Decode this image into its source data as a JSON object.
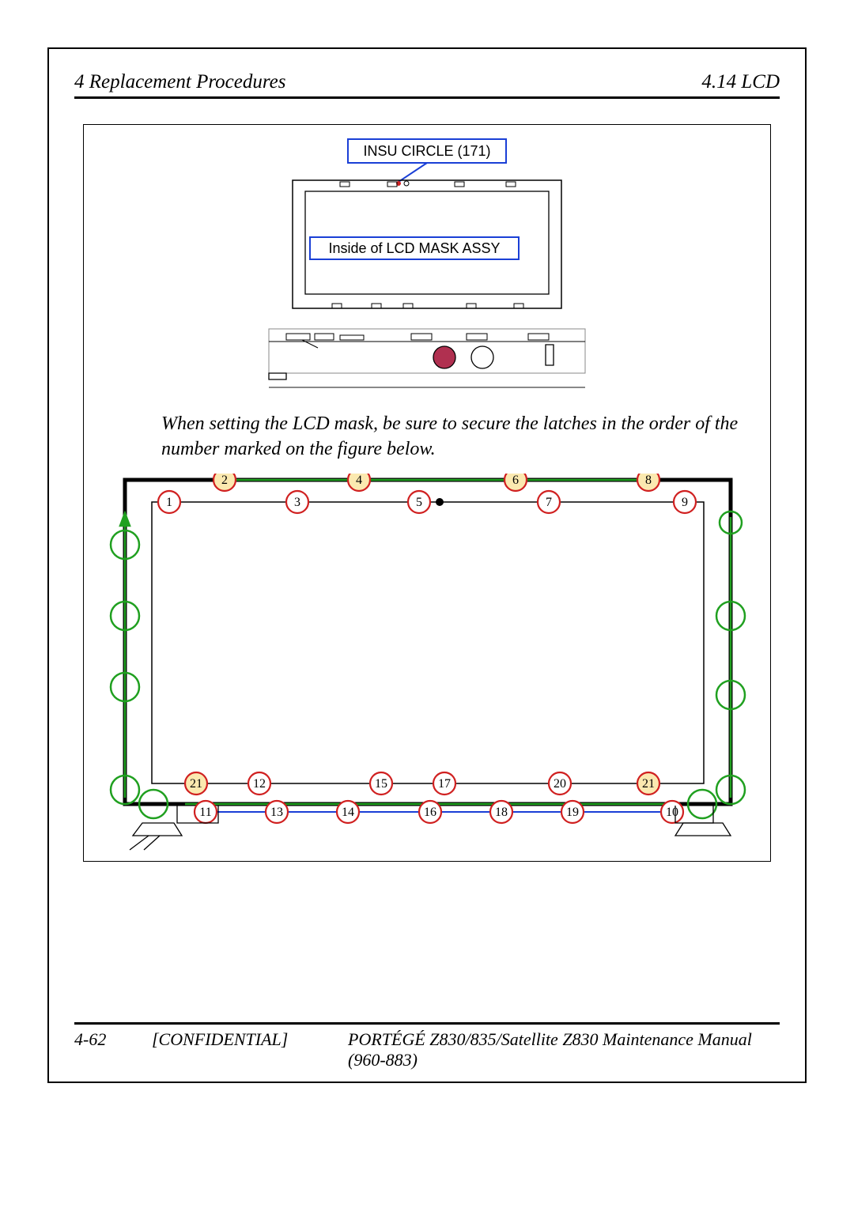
{
  "header": {
    "left": "4 Replacement Procedures",
    "right": "4.14 LCD"
  },
  "labels": {
    "insu_circle": "INSU CIRCLE (171)",
    "inside_mask": "Inside of LCD MASK ASSY"
  },
  "caption": "When setting the LCD mask, be sure to secure the latches in the order of the number marked on the figure below.",
  "latch_numbers_top_outer": [
    "2",
    "4",
    "6",
    "8"
  ],
  "latch_numbers_top_inner": [
    "1",
    "3",
    "5",
    "7",
    "9"
  ],
  "latch_numbers_bottom_inner": [
    "21",
    "12",
    "15",
    "17",
    "20",
    "21"
  ],
  "latch_numbers_bottom_outer": [
    "11",
    "13",
    "14",
    "16",
    "18",
    "19",
    "10"
  ],
  "footer": {
    "page": "4-62",
    "confidential": "[CONFIDENTIAL]",
    "doc_title": "PORTÉGÉ Z830/835/Satellite Z830 Maintenance Manual (960-883)"
  },
  "colors": {
    "blue": "#1a3fd6",
    "red": "#d02020",
    "green": "#20a020",
    "orange": "#e08000",
    "crimson": "#b03050"
  }
}
